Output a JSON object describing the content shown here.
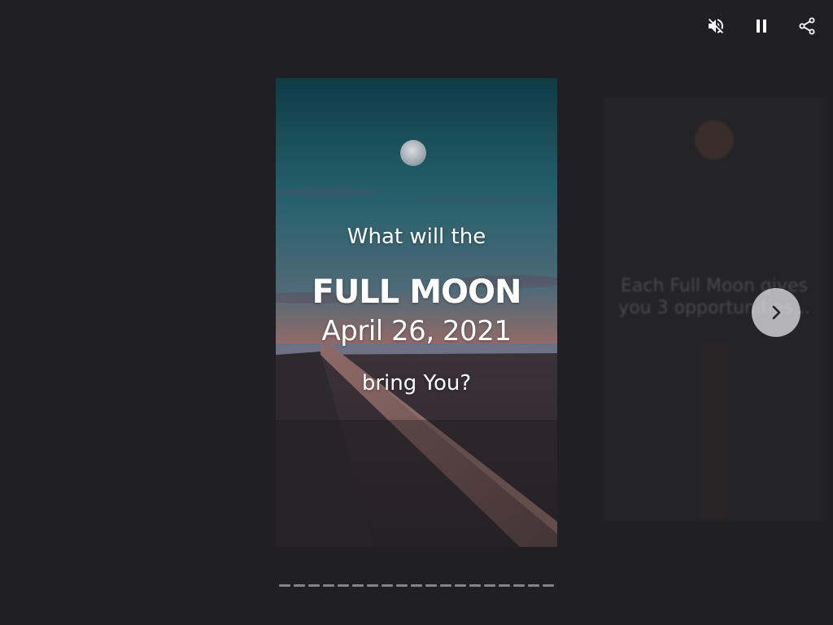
{
  "controls": {
    "mute_icon": "volume-muted-icon",
    "pause_icon": "pause-icon",
    "share_icon": "share-icon"
  },
  "story": {
    "line1": "What will the",
    "line2": "FULL MOON",
    "line3": "April 26, 2021",
    "line4": "bring You?"
  },
  "next_preview": {
    "text_line1": "Each Full Moon gives",
    "text_line2": "you 3 opportunities..."
  },
  "next_button_icon": "chevron-right-icon",
  "progress": {
    "segment_count": 19,
    "current_index": 0,
    "current_fill": 0.0
  },
  "colors": {
    "page_background": "#202024",
    "text": "#ffffff",
    "progress_track": "#8a8a8e"
  }
}
